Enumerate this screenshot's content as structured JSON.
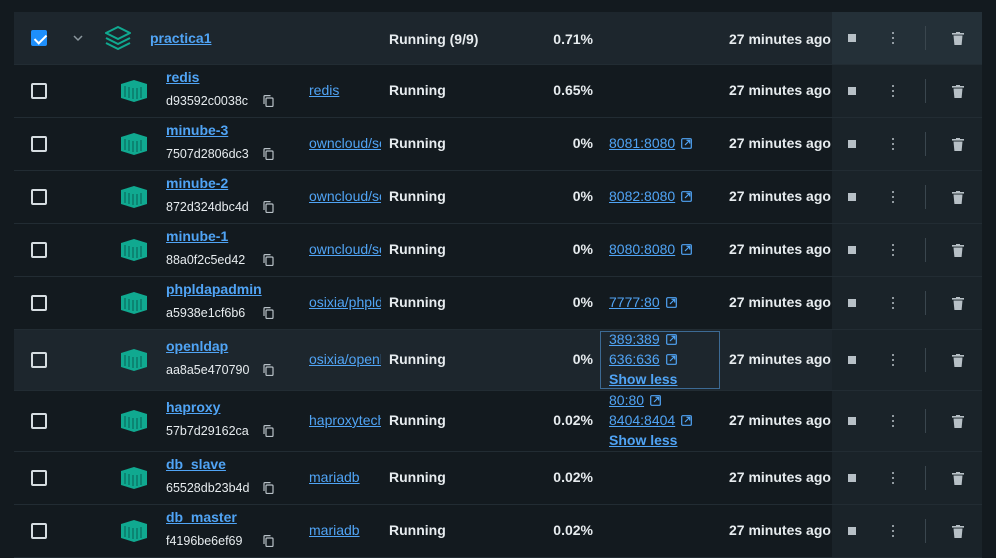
{
  "group": {
    "name": "practica1",
    "status": "Running (9/9)",
    "cpu": "0.71%",
    "last_started": "27 minutes ago",
    "checked": true
  },
  "containers": [
    {
      "name": "redis",
      "id": "d93592c0038c",
      "image": "redis",
      "status": "Running",
      "cpu": "0.65%",
      "ports": [],
      "last_started": "27 minutes ago"
    },
    {
      "name": "minube-3",
      "id": "7507d2806dc3",
      "image": "owncloud/server",
      "status": "Running",
      "cpu": "0%",
      "ports": [
        "8081:8080"
      ],
      "last_started": "27 minutes ago"
    },
    {
      "name": "minube-2",
      "id": "872d324dbc4d",
      "image": "owncloud/server",
      "status": "Running",
      "cpu": "0%",
      "ports": [
        "8082:8080"
      ],
      "last_started": "27 minutes ago"
    },
    {
      "name": "minube-1",
      "id": "88a0f2c5ed42",
      "image": "owncloud/server",
      "status": "Running",
      "cpu": "0%",
      "ports": [
        "8080:8080"
      ],
      "last_started": "27 minutes ago"
    },
    {
      "name": "phpldapadmin",
      "id": "a5938e1cf6b6",
      "image": "osixia/phpldapadmin",
      "status": "Running",
      "cpu": "0%",
      "ports": [
        "7777:80"
      ],
      "last_started": "27 minutes ago"
    },
    {
      "name": "openldap",
      "id": "aa8a5e470790",
      "image": "osixia/openldap",
      "status": "Running",
      "cpu": "0%",
      "ports": [
        "389:389",
        "636:636"
      ],
      "show_less": "Show less",
      "last_started": "27 minutes ago"
    },
    {
      "name": "haproxy",
      "id": "57b7d29162ca",
      "image": "haproxytech/haproxy",
      "status": "Running",
      "cpu": "0.02%",
      "ports": [
        "80:80",
        "8404:8404"
      ],
      "show_less": "Show less",
      "last_started": "27 minutes ago"
    },
    {
      "name": "db_slave",
      "id": "65528db23b4d",
      "image": "mariadb",
      "status": "Running",
      "cpu": "0.02%",
      "ports": [],
      "last_started": "27 minutes ago"
    },
    {
      "name": "db_master",
      "id": "f4196be6ef69",
      "image": "mariadb",
      "status": "Running",
      "cpu": "0.02%",
      "ports": [],
      "last_started": "27 minutes ago"
    }
  ],
  "colors": {
    "accent": "#1e8ffb",
    "link": "#50a4f5",
    "container_icon": "#10a990",
    "background": "#131a1f"
  },
  "icons": {
    "stack": "stack-icon",
    "container": "container-icon",
    "copy": "copy-icon",
    "external": "external-link-icon",
    "stop": "stop-icon",
    "more": "kebab-menu-icon",
    "delete": "trash-icon",
    "expand": "chevron-down-icon"
  }
}
